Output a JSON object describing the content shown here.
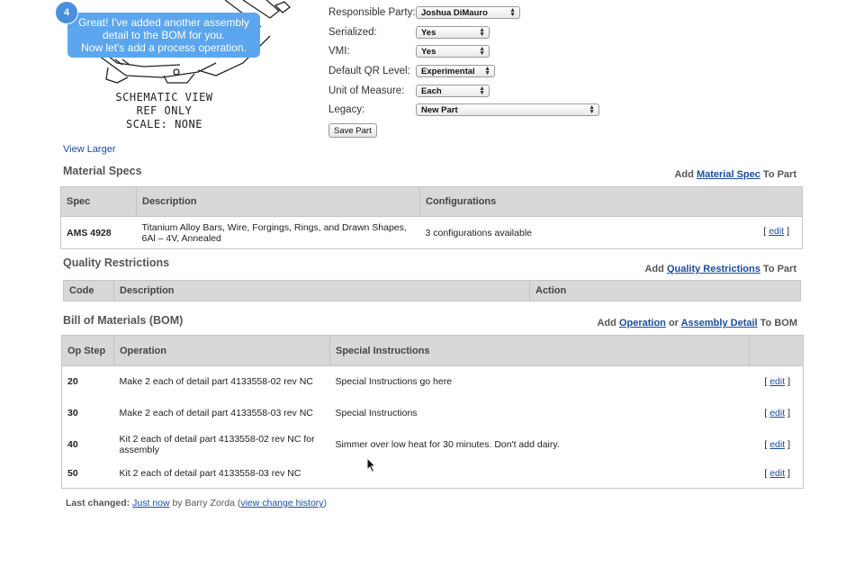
{
  "tooltip": {
    "step": "4",
    "lines": [
      "Great! I've added another assembly",
      "detail to the BOM for you.",
      "Now let's add a process operation."
    ]
  },
  "schematic": {
    "lines": [
      "SCHEMATIC VIEW",
      "REF ONLY",
      "SCALE: NONE"
    ],
    "view_larger": "View Larger"
  },
  "form": {
    "responsible_party": {
      "label": "Responsible Party:",
      "value": "Joshua DiMauro"
    },
    "serialized": {
      "label": "Serialized:",
      "value": "Yes"
    },
    "vmi": {
      "label": "VMI:",
      "value": "Yes"
    },
    "qr_level": {
      "label": "Default QR Level:",
      "value": "Experimental"
    },
    "uom": {
      "label": "Unit of Measure:",
      "value": "Each"
    },
    "legacy": {
      "label": "Legacy:",
      "value": "New Part"
    },
    "save_label": "Save Part"
  },
  "material_specs": {
    "title": "Material Specs",
    "add_prefix": "Add ",
    "add_link": "Material Spec",
    "add_suffix": " To Part",
    "headers": [
      "Spec",
      "Description",
      "Configurations"
    ],
    "rows": [
      {
        "spec": "AMS 4928",
        "description": "Titanium Alloy Bars, Wire, Forgings, Rings, and Drawn Shapes, 6Al – 4V, Annealed",
        "configurations": "3 configurations available",
        "edit": "edit"
      }
    ]
  },
  "quality_restrictions": {
    "title": "Quality Restrictions",
    "add_prefix": "Add ",
    "add_link": "Quality Restrictions",
    "add_suffix": " To Part",
    "headers": [
      "Code",
      "Description",
      "Action"
    ]
  },
  "bom": {
    "title": "Bill of Materials (BOM)",
    "add_prefix": "Add ",
    "add_link1": "Operation",
    "add_mid": " or ",
    "add_link2": "Assembly Detail",
    "add_suffix": " To BOM",
    "headers": [
      "Op Step",
      "Operation",
      "Special Instructions"
    ],
    "rows": [
      {
        "step": "20",
        "operation": "Make 2 each of detail part  4133558-02 rev NC",
        "instructions": "Special Instructions go here",
        "edit": "edit"
      },
      {
        "step": "30",
        "operation": "Make 2 each of detail part 4133558-03 rev NC",
        "instructions": "Special Instructions",
        "edit": "edit"
      },
      {
        "step": "40",
        "operation": "Kit 2 each of detail part 4133558-02 rev NC for assembly",
        "instructions": "Simmer over low heat for 30 minutes. Don't add dairy.",
        "edit": "edit"
      },
      {
        "step": "50",
        "operation": "Kit 2 each of detail part 4133558-03 rev NC",
        "instructions": "",
        "edit": "edit"
      }
    ]
  },
  "last_changed": {
    "label": "Last changed: ",
    "when": "Just now",
    "by": " by Barry Zorda (",
    "history": "view change history",
    "close": ")"
  }
}
